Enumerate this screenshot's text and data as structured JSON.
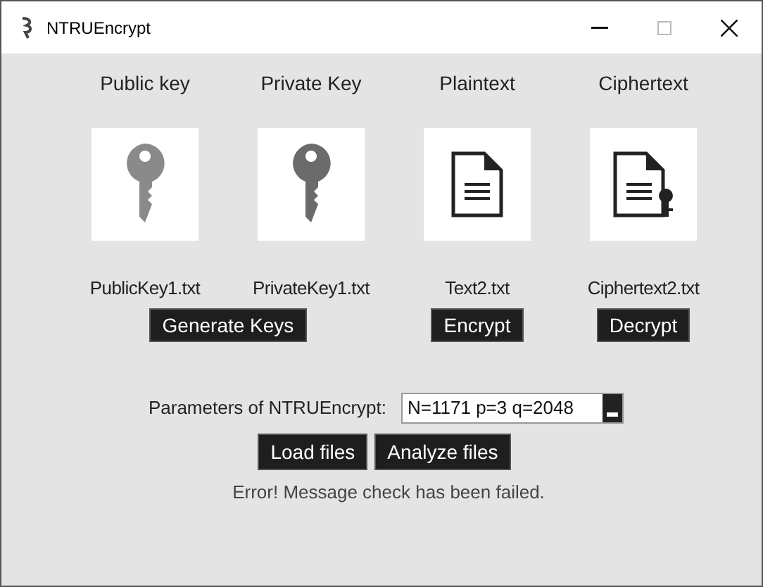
{
  "window": {
    "title": "NTRUEncrypt"
  },
  "columns": [
    {
      "heading": "Public key",
      "kind": "public-key",
      "file": "PublicKey1.txt"
    },
    {
      "heading": "Private Key",
      "kind": "private-key",
      "file": "PrivateKey1.txt"
    },
    {
      "heading": "Plaintext",
      "kind": "document",
      "file": "Text2.txt"
    },
    {
      "heading": "Ciphertext",
      "kind": "locked-document",
      "file": "Ciphertext2.txt"
    }
  ],
  "action_buttons": [
    "Generate Keys",
    "Encrypt",
    "Decrypt"
  ],
  "parameters": {
    "label": "Parameters of NTRUEncrypt:",
    "value": "N=1171 p=3 q=2048"
  },
  "file_buttons": [
    "Load files",
    "Analyze files"
  ],
  "status": "Error! Message check has been failed."
}
